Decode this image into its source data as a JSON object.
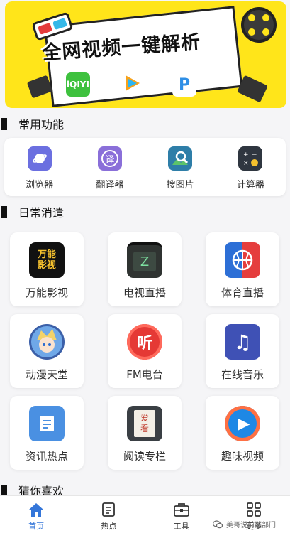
{
  "banner": {
    "headline": "全网视频一键解析",
    "apps": [
      "iQIYI",
      "",
      "P"
    ]
  },
  "sections": {
    "common": "常用功能",
    "leisure": "日常消遣",
    "guess": "猜你喜欢"
  },
  "common_items": [
    {
      "label": "浏览器",
      "icon": "browser-icon"
    },
    {
      "label": "翻译器",
      "icon": "translate-icon",
      "glyph": "译"
    },
    {
      "label": "搜图片",
      "icon": "image-search-icon"
    },
    {
      "label": "计算器",
      "icon": "calculator-icon"
    }
  ],
  "tiles": [
    {
      "label": "万能影视",
      "icon": "movie-icon",
      "glyph": "万能\n影视"
    },
    {
      "label": "电视直播",
      "icon": "tv-icon",
      "glyph": "Z"
    },
    {
      "label": "体育直播",
      "icon": "basketball-icon"
    },
    {
      "label": "动漫天堂",
      "icon": "anime-avatar-icon"
    },
    {
      "label": "FM电台",
      "icon": "radio-icon",
      "glyph": "听"
    },
    {
      "label": "在线音乐",
      "icon": "music-note-icon",
      "glyph": "♫"
    },
    {
      "label": "资讯热点",
      "icon": "news-icon"
    },
    {
      "label": "阅读专栏",
      "icon": "book-icon",
      "glyph": "爱\n看"
    },
    {
      "label": "趣味视频",
      "icon": "play-icon",
      "glyph": "▶"
    }
  ],
  "nav": [
    {
      "label": "首页",
      "icon": "home-icon",
      "active": true
    },
    {
      "label": "热点",
      "icon": "hot-list-icon"
    },
    {
      "label": "工具",
      "icon": "toolbox-icon"
    },
    {
      "label": "更多",
      "icon": "grid-icon"
    }
  ],
  "watermark": "美哥说前端部门",
  "colors": {
    "accent": "#3476d9",
    "banner_bg": "#ffe51a",
    "page_bg": "#f5f5f7"
  }
}
